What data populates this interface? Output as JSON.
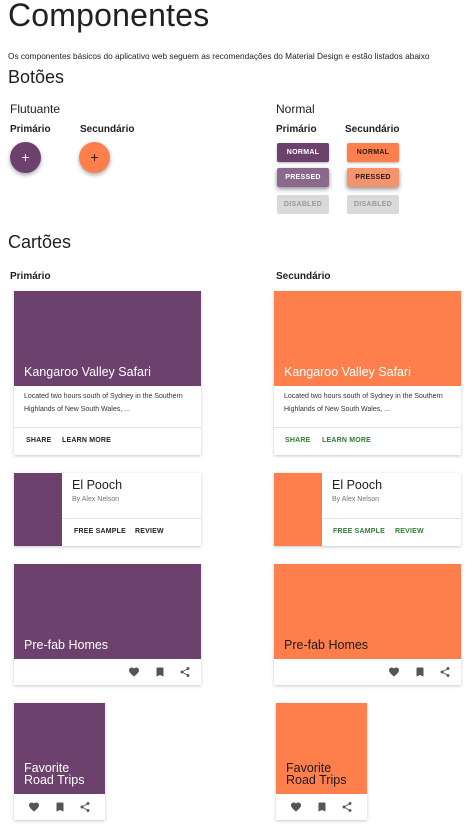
{
  "page": {
    "title": "Componentes",
    "intro": "Os componentes básicos do aplicativo web seguem as recomendações do Material Design e estão listados abaixo"
  },
  "colors": {
    "primary": "#6d416e",
    "primary_pressed": "#8a6a8b",
    "secondary": "#ff7f4c",
    "secondary_pressed": "#f4946e",
    "disabled_bg": "#d9d9d9",
    "action_primary": "#212121",
    "action_secondary": "#2e7d32"
  },
  "buttons_section": {
    "title": "Botões",
    "floating": {
      "heading": "Flutuante",
      "primary_label": "Primário",
      "secondary_label": "Secundário",
      "fab_symbol": "+",
      "fab_icon": "plus-icon"
    },
    "normal": {
      "heading": "Normal",
      "primary_label": "Primário",
      "secondary_label": "Secundário",
      "normal_label": "NORMAL",
      "pressed_label": "PRESSED",
      "disabled_label": "DISABLED"
    }
  },
  "cards_section": {
    "title": "Cartões",
    "primary_label": "Primário",
    "secondary_label": "Secundário",
    "media_card": {
      "title": "Kangaroo Valley Safari",
      "description": "Located two hours south of Sydney in the Southern Highlands of New South Wales, ...",
      "actions": [
        "SHARE",
        "LEARN MORE"
      ]
    },
    "horizontal_card": {
      "title": "El Pooch",
      "subtitle": "By Alex Nelson",
      "actions": [
        "FREE SAMPLE",
        "REVIEW"
      ]
    },
    "wide_icon_card": {
      "title": "Pre-fab Homes",
      "icons": [
        "heart-icon",
        "bookmark-icon",
        "share-icon"
      ]
    },
    "small_icon_card": {
      "title_line1": "Favorite",
      "title_line2": "Road Trips",
      "icons": [
        "heart-icon",
        "bookmark-icon",
        "share-icon"
      ]
    }
  }
}
